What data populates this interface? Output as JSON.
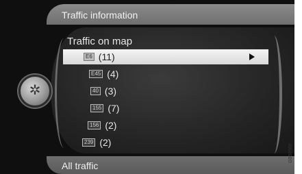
{
  "header": {
    "title": "Traffic information"
  },
  "list": {
    "title": "Traffic on map",
    "items": [
      {
        "road": "E6",
        "count": "(11)",
        "selected": true
      },
      {
        "road": "E45",
        "count": "(4)"
      },
      {
        "road": "40",
        "count": "(3)"
      },
      {
        "road": "155",
        "count": "(7)"
      },
      {
        "road": "156",
        "count": "(2)"
      },
      {
        "road": "239",
        "count": "(2)"
      }
    ]
  },
  "footer": {
    "label": "All traffic"
  },
  "image_code": "G050568",
  "icons": {
    "knob": "rotary-knob-icon",
    "arrow": "play-arrow-icon"
  },
  "colors": {
    "selection": "#eeeeee",
    "background": "#0f0f0f",
    "header": "#7c7c7c"
  }
}
